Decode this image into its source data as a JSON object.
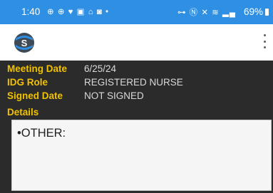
{
  "status_bar": {
    "time": "1:40",
    "notification_icons": "⊕ ⊕ ♥ ▣ ⌂ ◙ •",
    "system_icons": "⊶ Ⓝ ✕ ≋ ▂▄",
    "battery": "69%",
    "background_color": "#2e8fe3"
  },
  "app_bar": {
    "logo": "app-logo-icon",
    "menu_icon": "more-vertical-icon"
  },
  "fields": {
    "meeting_date_label": "Meeting Date",
    "meeting_date_value": "6/25/24",
    "idg_role_label": "IDG Role",
    "idg_role_value": "REGISTERED NURSE",
    "signed_date_label": "Signed Date",
    "signed_date_value": "NOT SIGNED"
  },
  "details": {
    "label": "Details",
    "text": "•OTHER:"
  },
  "colors": {
    "label": "#f2c200",
    "panel_bg": "#2b2b2b",
    "value": "#d9d9d9"
  }
}
